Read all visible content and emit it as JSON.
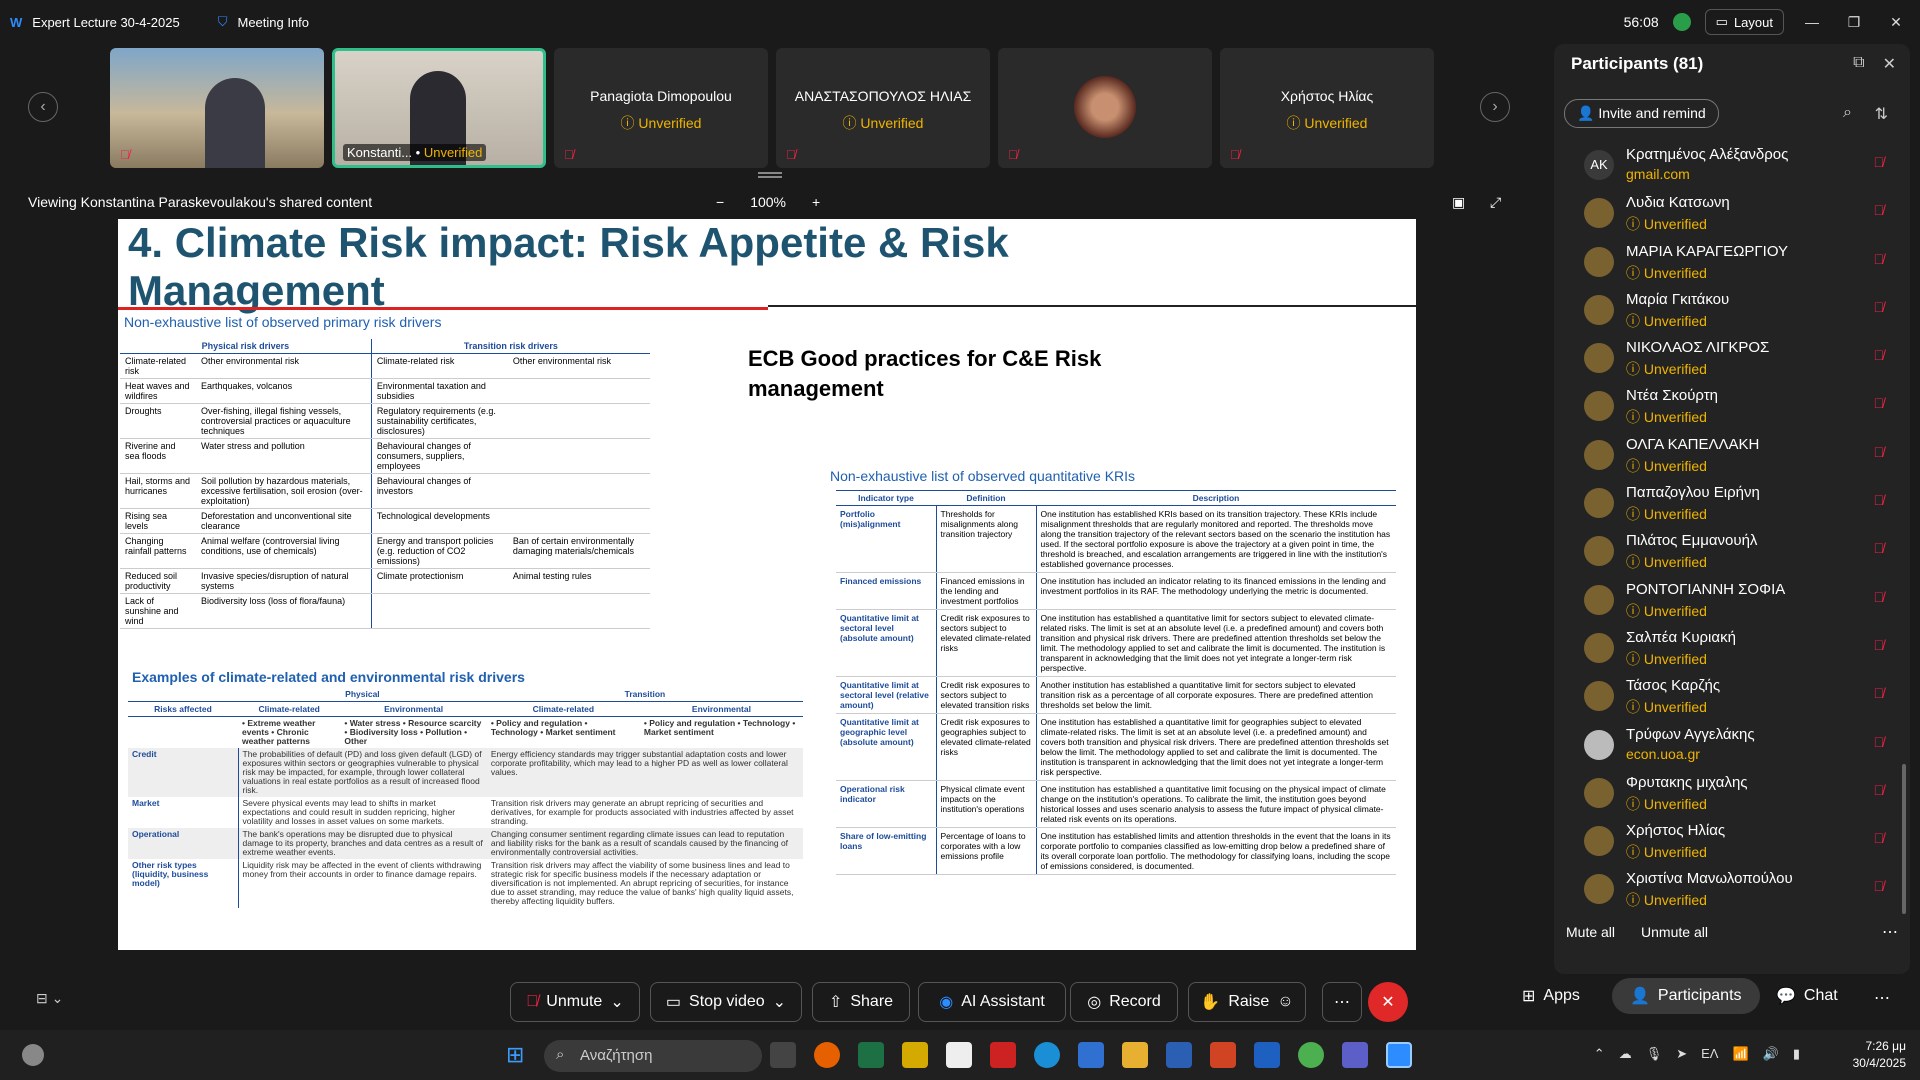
{
  "window": {
    "title": "Expert Lecture 30-4-2025",
    "meeting_info": "Meeting Info",
    "timer": "56:08",
    "layout_label": "Layout"
  },
  "video_tiles": [
    {
      "name": "",
      "status": ""
    },
    {
      "name": "Konstanti...",
      "status": "Unverified"
    },
    {
      "name": "Panagiota Dimopoulou",
      "status": "Unverified"
    },
    {
      "name": "ΑΝΑΣΤΑΣΟΠΟΥΛΟΣ ΗΛΙΑΣ",
      "status": "Unverified"
    },
    {
      "name": "",
      "status": ""
    },
    {
      "name": "Χρήστος Ηλίας",
      "status": "Unverified"
    }
  ],
  "share": {
    "label": "Viewing Konstantina Paraskevoulakou's shared content",
    "zoom": "100%"
  },
  "slide": {
    "title": "4. Climate Risk impact: Risk Appetite & Risk Management",
    "primary_list_title": "Non-exhaustive list of observed primary risk drivers",
    "physical_header": "Physical risk drivers",
    "transition_header": "Transition risk drivers",
    "drivers": [
      [
        "Climate-related risk",
        "Other environmental risk",
        "Climate-related risk",
        "Other environmental risk"
      ],
      [
        "Heat waves and wildfires",
        "Earthquakes, volcanos",
        "Environmental taxation and subsidies",
        ""
      ],
      [
        "Droughts",
        "Over-fishing, illegal fishing vessels, controversial practices or aquaculture techniques",
        "Regulatory requirements (e.g. sustainability certificates, disclosures)",
        ""
      ],
      [
        "Riverine and sea floods",
        "Water stress and pollution",
        "Behavioural changes of consumers, suppliers, employees",
        ""
      ],
      [
        "Hail, storms and hurricanes",
        "Soil pollution by hazardous materials, excessive fertilisation, soil erosion (over-exploitation)",
        "Behavioural changes of investors",
        ""
      ],
      [
        "Rising sea levels",
        "Deforestation and unconventional site clearance",
        "Technological developments",
        ""
      ],
      [
        "Changing rainfall patterns",
        "Animal welfare (controversial living conditions, use of chemicals)",
        "Energy and transport policies (e.g. reduction of CO2 emissions)",
        "Ban of certain environmentally damaging materials/chemicals"
      ],
      [
        "Reduced soil productivity",
        "Invasive species/disruption of natural systems",
        "Climate protectionism",
        "Animal testing rules"
      ],
      [
        "Lack of sunshine and wind",
        "Biodiversity loss (loss of flora/fauna)",
        "",
        ""
      ]
    ],
    "ecb_title": "ECB Good practices for C&E Risk management",
    "kri_title": "Non-exhaustive list of observed quantitative KRIs",
    "kri_headers": [
      "Indicator type",
      "Definition",
      "Description"
    ],
    "kris": [
      [
        "Portfolio (mis)alignment",
        "Thresholds for misalignments along transition trajectory",
        "One institution has established KRIs based on its transition trajectory. These KRIs include misalignment thresholds that are regularly monitored and reported. The thresholds move along the transition trajectory of the relevant sectors based on the scenario the institution has used. If the sectoral portfolio exposure is above the trajectory at a given point in time, the threshold is breached, and escalation arrangements are triggered in line with the institution's established governance processes."
      ],
      [
        "Financed emissions",
        "Financed emissions in the lending and investment portfolios",
        "One institution has included an indicator relating to its financed emissions in the lending and investment portfolios in its RAF. The methodology underlying the metric is documented."
      ],
      [
        "Quantitative limit at sectoral level (absolute amount)",
        "Credit risk exposures to sectors subject to elevated climate-related risks",
        "One institution has established a quantitative limit for sectors subject to elevated climate-related risks. The limit is set at an absolute level (i.e. a predefined amount) and covers both transition and physical risk drivers. There are predefined attention thresholds set below the limit. The methodology applied to set and calibrate the limit is documented. The institution is transparent in acknowledging that the limit does not yet integrate a longer-term risk perspective."
      ],
      [
        "Quantitative limit at sectoral level (relative amount)",
        "Credit risk exposures to sectors subject to elevated transition risks",
        "Another institution has established a quantitative limit for sectors subject to elevated transition risk as a percentage of all corporate exposures. There are predefined attention thresholds set below the limit."
      ],
      [
        "Quantitative limit at geographic level (absolute amount)",
        "Credit risk exposures to geographies subject to elevated climate-related risks",
        "One institution has established a quantitative limit for geographies subject to elevated climate-related risks. The limit is set at an absolute level (i.e. a predefined amount) and covers both transition and physical risk drivers. There are predefined attention thresholds set below the limit. The methodology applied to set and calibrate the limit is documented. The institution is transparent in acknowledging that the limit does not yet integrate a longer-term risk perspective."
      ],
      [
        "Operational risk indicator",
        "Physical climate event impacts on the institution's operations",
        "One institution has established a quantitative limit focusing on the physical impact of climate change on the institution's operations. To calibrate the limit, the institution goes beyond historical losses and uses scenario analysis to assess the future impact of physical climate-related risk events on its operations."
      ],
      [
        "Share of low-emitting loans",
        "Percentage of loans to corporates with a low emissions profile",
        "One institution has established limits and attention thresholds in the event that the loans in its corporate portfolio to companies classified as low-emitting drop below a predefined share of its overall corporate loan portfolio. The methodology for classifying loans, including the scope of emissions considered, is documented."
      ]
    ],
    "examples_title": "Examples of climate-related and environmental risk drivers",
    "ex_top_headers": [
      "Physical",
      "Transition"
    ],
    "ex_headers": [
      "Risks affected",
      "Climate-related",
      "Environmental",
      "Climate-related",
      "Environmental"
    ],
    "ex_lists": [
      "• Extreme weather events • Chronic weather patterns",
      "• Water stress • Resource scarcity • Biodiversity loss • Pollution • Other",
      "• Policy and regulation • Technology • Market sentiment",
      "• Policy and regulation • Technology • Market sentiment"
    ],
    "ex_rows": [
      [
        "Credit",
        "The probabilities of default (PD) and loss given default (LGD) of exposures within sectors or geographies vulnerable to physical risk may be impacted, for example, through lower collateral valuations in real estate portfolios as a result of increased flood risk.",
        "Energy efficiency standards may trigger substantial adaptation costs and lower corporate profitability, which may lead to a higher PD as well as lower collateral values."
      ],
      [
        "Market",
        "Severe physical events may lead to shifts in market expectations and could result in sudden repricing, higher volatility and losses in asset values on some markets.",
        "Transition risk drivers may generate an abrupt repricing of securities and derivatives, for example for products associated with industries affected by asset stranding."
      ],
      [
        "Operational",
        "The bank's operations may be disrupted due to physical damage to its property, branches and data centres as a result of extreme weather events.",
        "Changing consumer sentiment regarding climate issues can lead to reputation and liability risks for the bank as a result of scandals caused by the financing of environmentally controversial activities."
      ],
      [
        "Other risk types (liquidity, business model)",
        "Liquidity risk may be affected in the event of clients withdrawing money from their accounts in order to finance damage repairs.",
        "Transition risk drivers may affect the viability of some business lines and lead to strategic risk for specific business models if the necessary adaptation or diversification is not implemented. An abrupt repricing of securities, for instance due to asset stranding, may reduce the value of banks' high quality liquid assets, thereby affecting liquidity buffers."
      ]
    ]
  },
  "participants": {
    "title": "Participants (81)",
    "invite_label": "Invite and remind",
    "items": [
      {
        "initials": "AK",
        "name": "Κρατημένος Αλέξανδρος",
        "status": "gmail.com"
      },
      {
        "initials": "",
        "name": "Λυδια  Κατσωνη",
        "status": "Unverified"
      },
      {
        "initials": "",
        "name": "ΜΑΡΙΑ ΚΑΡΑΓΕΩΡΓΙΟΥ",
        "status": "Unverified"
      },
      {
        "initials": "",
        "name": "Μαρία Γκιτάκου",
        "status": "Unverified"
      },
      {
        "initials": "",
        "name": "ΝΙΚΟΛΑΟΣ ΛΙΓΚΡΟΣ",
        "status": "Unverified"
      },
      {
        "initials": "",
        "name": "Ντέα Σκούρτη",
        "status": "Unverified"
      },
      {
        "initials": "",
        "name": "ΟΛΓΑ ΚΑΠΕΛΛΑΚΗ",
        "status": "Unverified"
      },
      {
        "initials": "",
        "name": "Παπαζογλου Ειρήνη",
        "status": "Unverified"
      },
      {
        "initials": "",
        "name": "Πιλάτος Εμμανουήλ",
        "status": "Unverified"
      },
      {
        "initials": "",
        "name": "ΡΟΝΤΟΓΙΑΝΝΗ ΣΟΦΙΑ",
        "status": "Unverified"
      },
      {
        "initials": "",
        "name": "Σαλπέα Κυριακή",
        "status": "Unverified"
      },
      {
        "initials": "",
        "name": "Τάσος Καρζής",
        "status": "Unverified"
      },
      {
        "initials": "",
        "name": "Τρύφων Αγγελάκης",
        "status": "econ.uoa.gr"
      },
      {
        "initials": "",
        "name": "Φρυτακης μιχαλης",
        "status": "Unverified"
      },
      {
        "initials": "",
        "name": "Χρήστος Ηλίας",
        "status": "Unverified"
      },
      {
        "initials": "",
        "name": "Χριστίνα Μανωλοπούλου",
        "status": "Unverified"
      }
    ],
    "mute_all": "Mute all",
    "unmute_all": "Unmute all"
  },
  "toolbar": {
    "unmute": "Unmute",
    "stop_video": "Stop video",
    "share": "Share",
    "ai_assistant": "AI Assistant",
    "record": "Record",
    "raise": "Raise",
    "apps": "Apps",
    "participants": "Participants",
    "chat": "Chat"
  },
  "taskbar": {
    "search_placeholder": "Αναζήτηση",
    "lang": "ΕΛ",
    "time": "7:26 μμ",
    "date": "30/4/2025"
  },
  "colors": {
    "accent_blue": "#1e5470",
    "unverified": "#f0b400",
    "leave_red": "#e02828",
    "muted_red": "#e22244"
  }
}
